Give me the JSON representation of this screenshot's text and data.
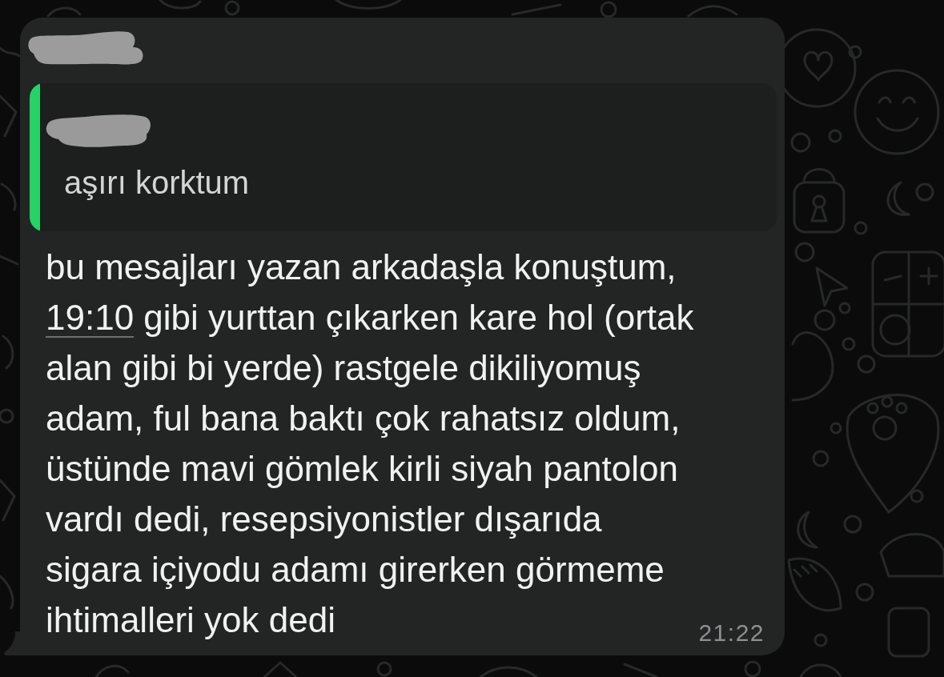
{
  "chat": {
    "message": {
      "quote": {
        "text": "aşırı korktum"
      },
      "body_lines": [
        [
          {
            "kind": "text",
            "text": "bu mesajları yazan arkadaşla konuştum,"
          }
        ],
        [
          {
            "kind": "link",
            "text": "19:10"
          },
          {
            "kind": "text",
            "text": " gibi yurttan çıkarken kare hol (ortak"
          }
        ],
        [
          {
            "kind": "text",
            "text": "alan gibi bi yerde) rastgele dikiliyomuş"
          }
        ],
        [
          {
            "kind": "text",
            "text": "adam, ful bana baktı çok rahatsız oldum,"
          }
        ],
        [
          {
            "kind": "text",
            "text": "üstünde mavi gömlek kirli siyah pantolon"
          }
        ],
        [
          {
            "kind": "text",
            "text": "vardı dedi, resepsiyonistler dışarıda"
          }
        ],
        [
          {
            "kind": "text",
            "text": "sigara içiyodu adamı girerken görmeme"
          }
        ],
        [
          {
            "kind": "text",
            "text": "ihtimalleri yok dedi"
          }
        ]
      ],
      "time": "21:22"
    }
  }
}
